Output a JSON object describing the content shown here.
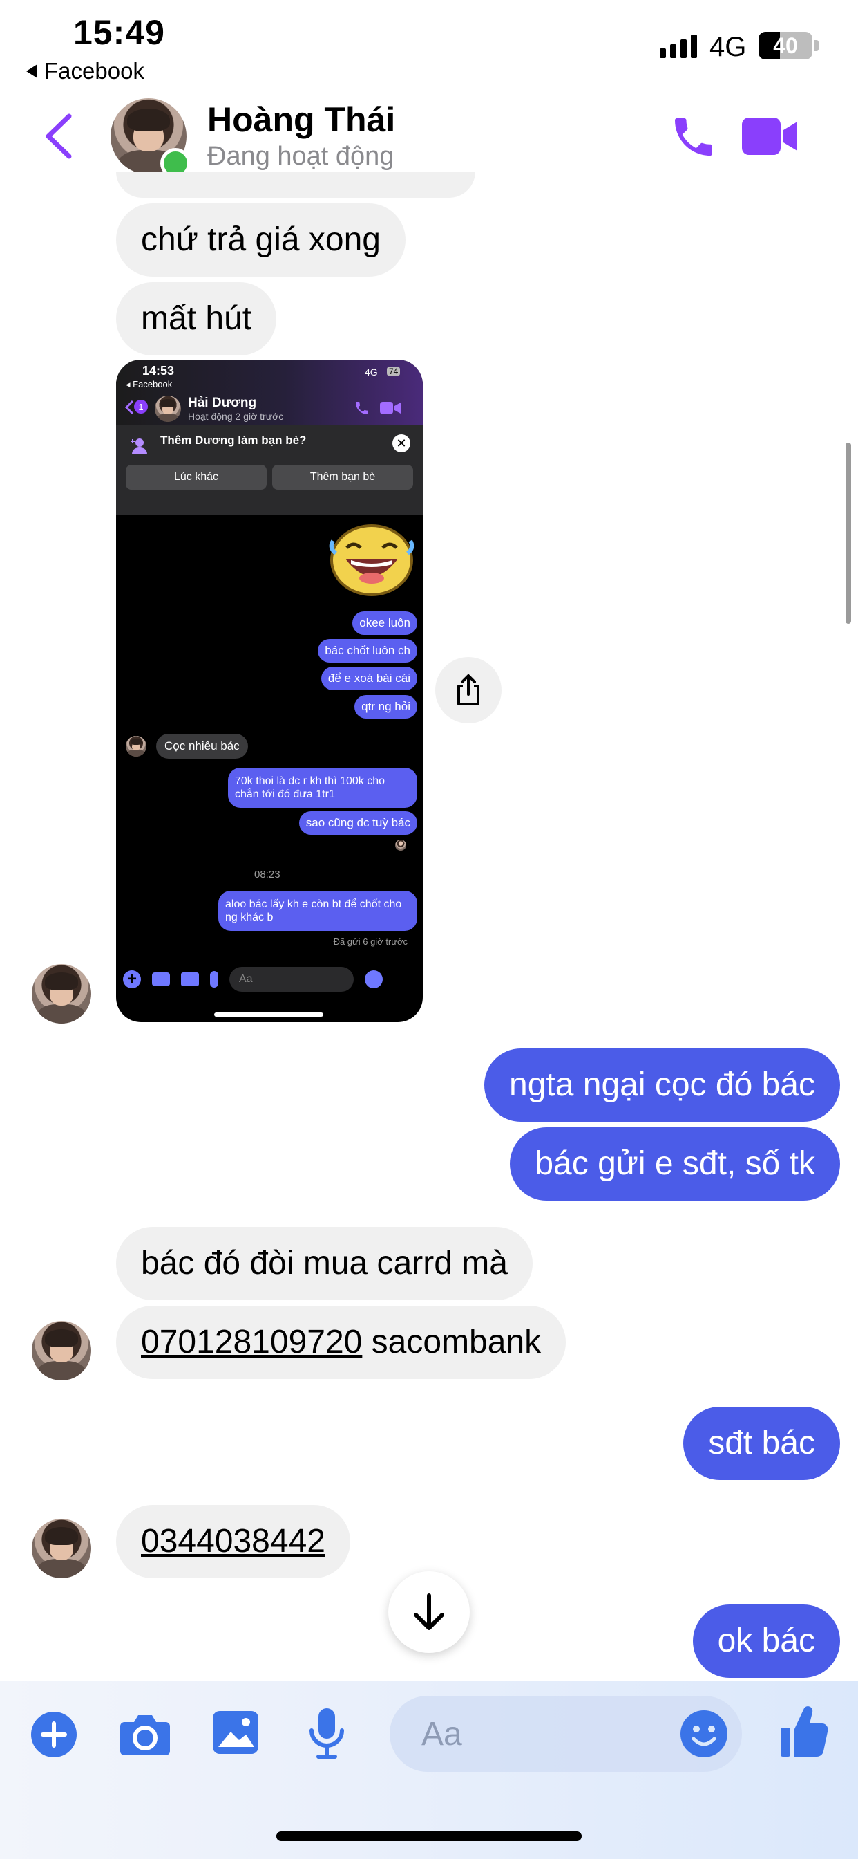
{
  "status_bar": {
    "time": "15:49",
    "back_app": "Facebook",
    "network": "4G",
    "battery": "40",
    "battery_level_percent": 40
  },
  "header": {
    "name": "Hoàng Thái",
    "status": "Đang hoạt động",
    "accent_color": "#8a3ffc"
  },
  "messages": [
    {
      "side": "received",
      "text": "chứ trả giá xong"
    },
    {
      "side": "received",
      "text": "mất hút"
    },
    {
      "side": "sent",
      "text": "ngta ngại cọc đó bác"
    },
    {
      "side": "sent",
      "text": "bác gửi e sđt, số tk"
    },
    {
      "side": "received",
      "text": "bác đó đòi mua carrd mà"
    },
    {
      "side": "received",
      "link": "070128109720",
      "text": " sacombank"
    },
    {
      "side": "sent",
      "text": "sđt bác"
    },
    {
      "side": "received",
      "link": "0344038442"
    },
    {
      "side": "sent",
      "text": "ok bác"
    }
  ],
  "shared_screenshot": {
    "time": "14:53",
    "back_app": "Facebook",
    "network": "4G",
    "battery": "74",
    "unread_badge": "1",
    "contact_name": "Hải Dương",
    "contact_status": "Hoạt động 2 giờ trước",
    "friend_prompt": "Thêm Dương làm bạn bè?",
    "btn_later": "Lúc khác",
    "btn_add_friend": "Thêm bạn bè",
    "messages": [
      "okee luôn",
      "bác chốt luôn ch",
      "để e xoá bài cái",
      "qtr ng hỏi",
      "Cọc nhiêu bác",
      "70k thoi là dc r kh thì 100k cho chắn tới đó đưa 1tr1",
      "sao cũng dc tuỳ bác",
      "08:23",
      "aloo bác lấy kh e còn bt để chốt cho ng khác b",
      "Đã gửi 6 giờ trước"
    ],
    "composer_placeholder": "Aa"
  },
  "composer": {
    "placeholder": "Aa",
    "icon_color": "#3b74e8"
  }
}
